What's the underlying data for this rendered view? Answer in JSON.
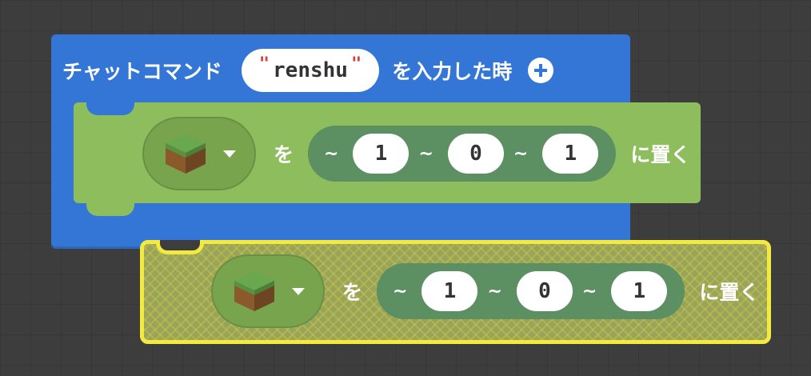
{
  "event_block": {
    "label_prefix": "チャットコマンド",
    "command_value": "renshu",
    "label_suffix": "を入力した時",
    "add_icon": "plus-circle-icon",
    "color": "#3476d6"
  },
  "place_block": {
    "block_icon": "grass-block-icon",
    "particle_wo": "を",
    "tilde": "~",
    "x": "1",
    "y": "0",
    "z": "1",
    "action": "に置く",
    "color": "#8ebd5e"
  },
  "dragged_block": {
    "block_icon": "grass-block-icon",
    "particle_wo": "を",
    "tilde": "~",
    "x": "1",
    "y": "0",
    "z": "1",
    "action": "に置く",
    "highlight_color": "#f4ea3f"
  }
}
